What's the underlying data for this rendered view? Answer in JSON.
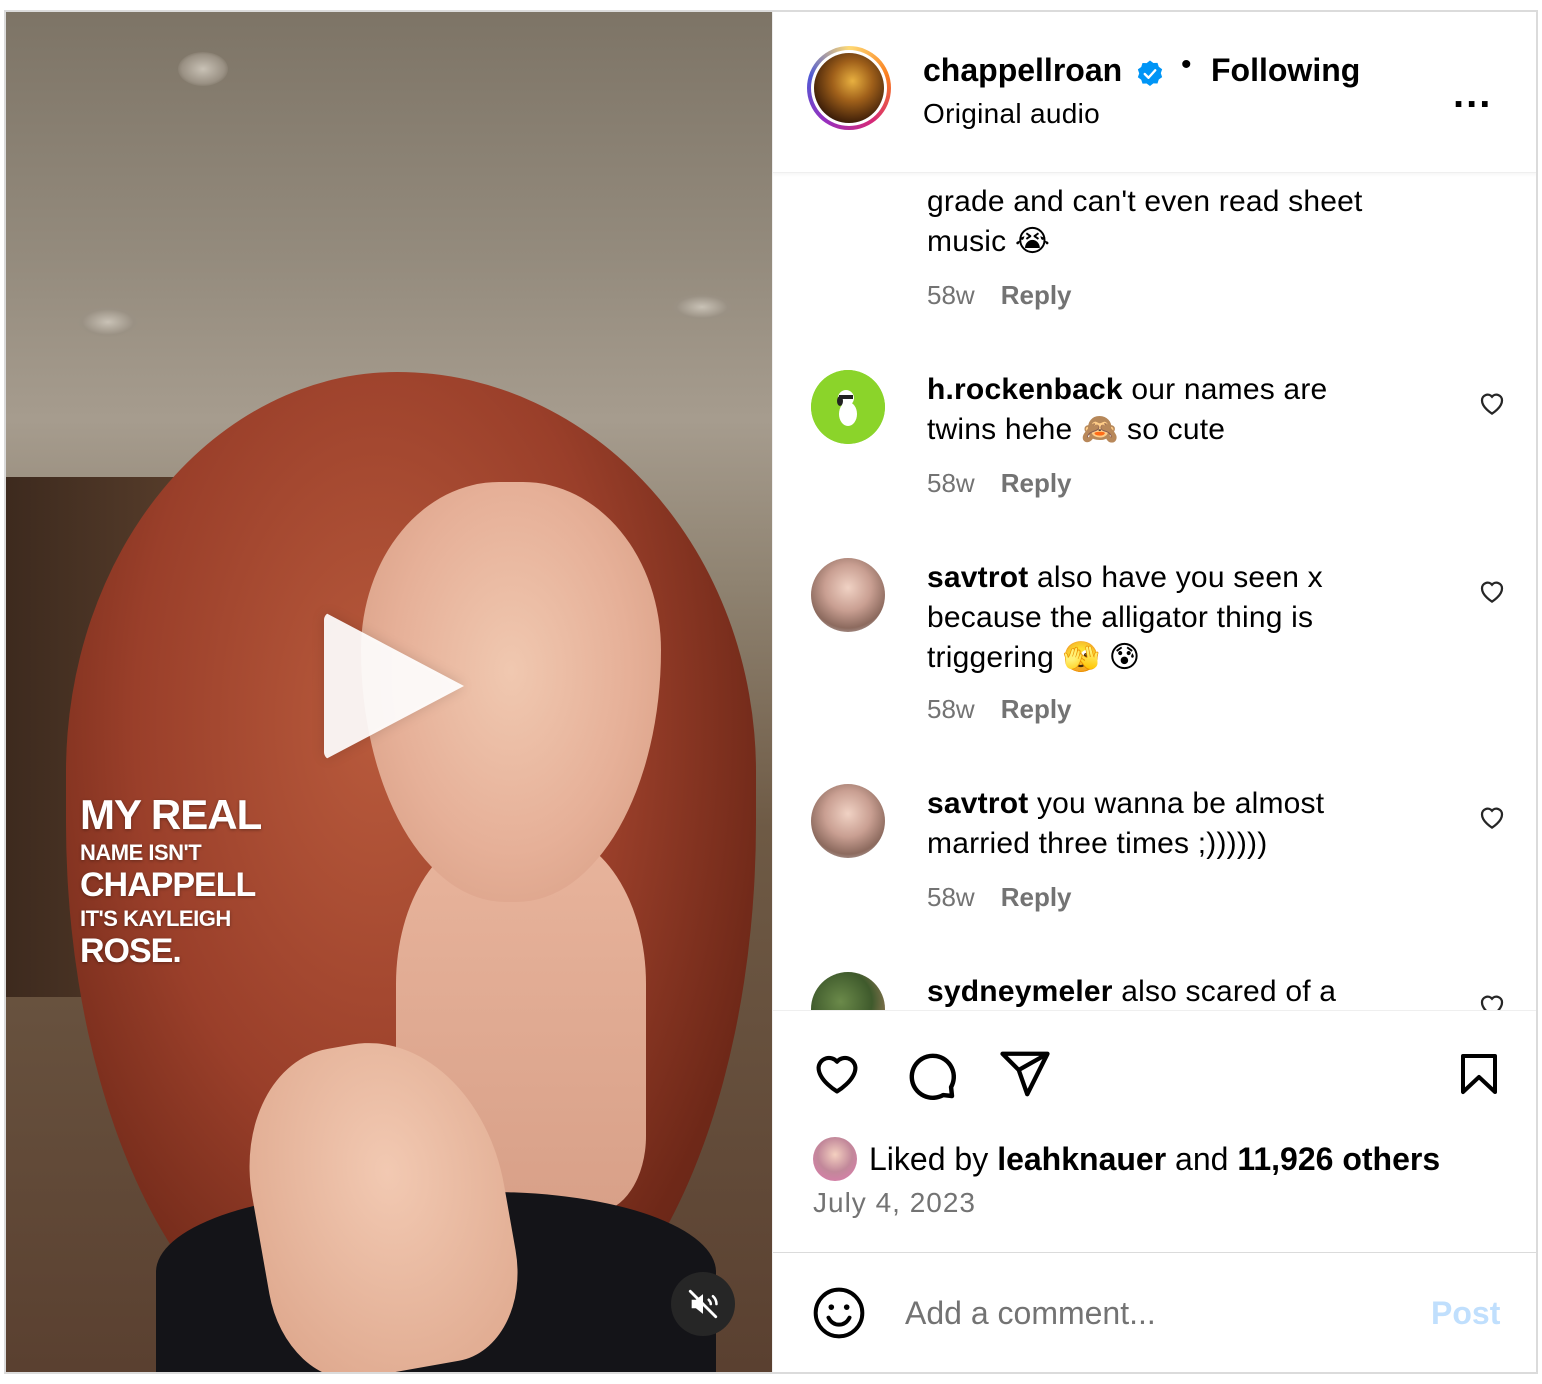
{
  "post": {
    "username": "chappellroan",
    "separator": "•",
    "follow_status": "Following",
    "audio": "Original audio",
    "more_label": "..."
  },
  "video": {
    "overlay_lines": [
      "MY REAL",
      "NAME ISN'T",
      "CHAPPELL",
      "IT'S KAYLEIGH",
      "ROSE."
    ],
    "muted": true
  },
  "comments": [
    {
      "user": "",
      "text_lines": [
        "grade and can't even read sheet",
        "music 😭"
      ],
      "age": "58w",
      "reply": "Reply"
    },
    {
      "user": "h.rockenback",
      "text_lines": [
        " our names are",
        "twins hehe 🙈 so cute"
      ],
      "age": "58w",
      "reply": "Reply"
    },
    {
      "user": "savtrot",
      "text_lines": [
        " also have you seen x",
        "because the alligator thing is",
        "triggering 🫣 😰"
      ],
      "age": "58w",
      "reply": "Reply"
    },
    {
      "user": "savtrot",
      "text_lines": [
        " you wanna be almost",
        "married three times ;))))))"
      ],
      "age": "58w",
      "reply": "Reply"
    },
    {
      "user": "sydneymeler",
      "text_lines": [
        " also scared of a"
      ],
      "age": "",
      "reply": ""
    }
  ],
  "likes": {
    "prefix": "Liked by ",
    "user": "leahknauer",
    "middle": " and ",
    "others": "11,926 others"
  },
  "date": "July 4, 2023",
  "composer": {
    "placeholder": "Add a comment...",
    "post_label": "Post"
  },
  "colors": {
    "verified": "#0095f6",
    "post_disabled": "#c0dffd",
    "muted_text": "#737373"
  }
}
